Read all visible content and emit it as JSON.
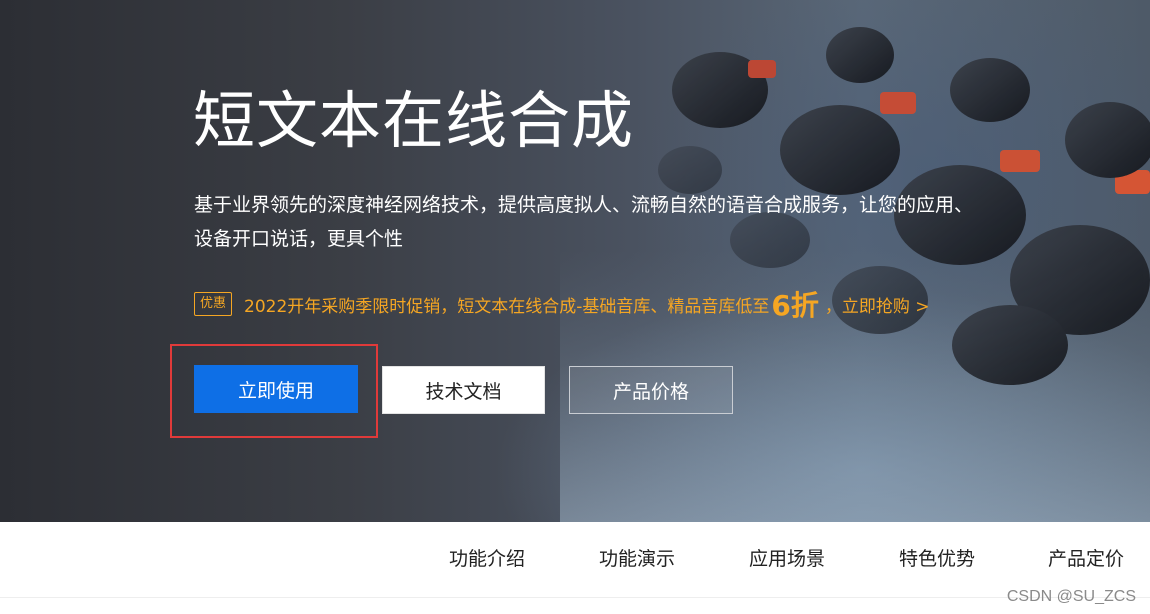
{
  "hero": {
    "title": "短文本在线合成",
    "description": "基于业界领先的深度神经网络技术，提供高度拟人、流畅自然的语音合成服务，让您的应用、设备开口说话，更具个性",
    "promo": {
      "badge": "优惠",
      "text_before": "2022开年采购季限时促销，短文本在线合成-基础音库、精品音库低至",
      "highlight": "6折",
      "text_after": "，立即抢购 >"
    },
    "buttons": {
      "primary": "立即使用",
      "docs": "技术文档",
      "pricing": "产品价格"
    }
  },
  "subnav": {
    "items": [
      "功能介绍",
      "功能演示",
      "应用场景",
      "特色优势",
      "产品定价"
    ]
  },
  "watermark": "CSDN @SU_ZCS",
  "colors": {
    "primary_button": "#0e6fe6",
    "promo": "#f5a623",
    "highlight_box": "#e03a3a"
  }
}
